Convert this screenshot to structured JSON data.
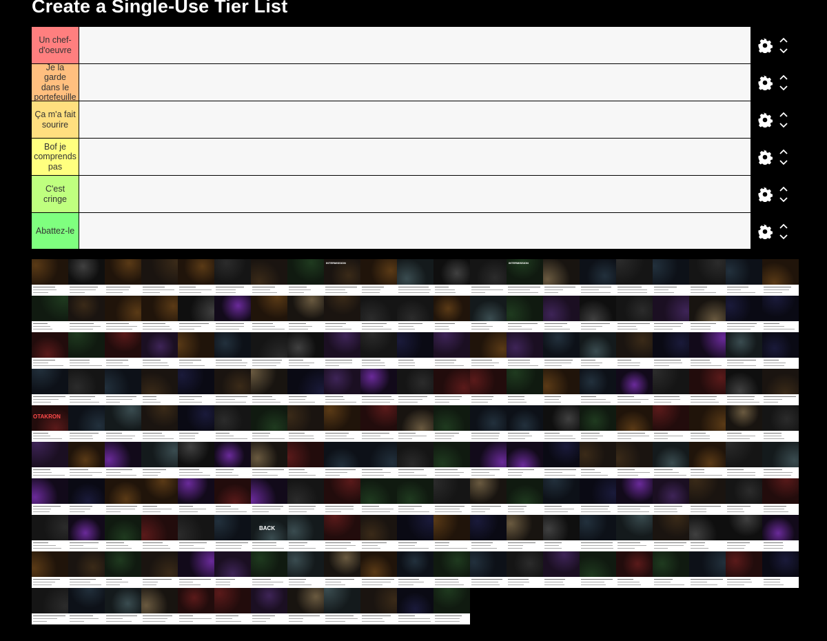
{
  "page": {
    "title": "Create a Single-Use Tier List"
  },
  "tiers": [
    {
      "label": "Un chef-d'oeuvre",
      "color": "#ff7f7f"
    },
    {
      "label": "Je la garde dans le portefeuille",
      "color": "#ffbf7f"
    },
    {
      "label": "Ça m'a fait sourire",
      "color": "#ffdf7f"
    },
    {
      "label": "Bof je comprends pas",
      "color": "#ffff7f"
    },
    {
      "label": "C'est cringe",
      "color": "#bfff7f"
    },
    {
      "label": "Abattez-le",
      "color": "#7fff7f"
    }
  ],
  "controls": {
    "settings_icon": "gear-icon",
    "move_up_icon": "chevron-up-icon",
    "move_down_icon": "chevron-down-icon"
  },
  "pool": {
    "item_count": 201,
    "tile_texts": {
      "otakron": "OTAKRON",
      "back": "BACK",
      "intermission": "INTERMISSION"
    }
  }
}
